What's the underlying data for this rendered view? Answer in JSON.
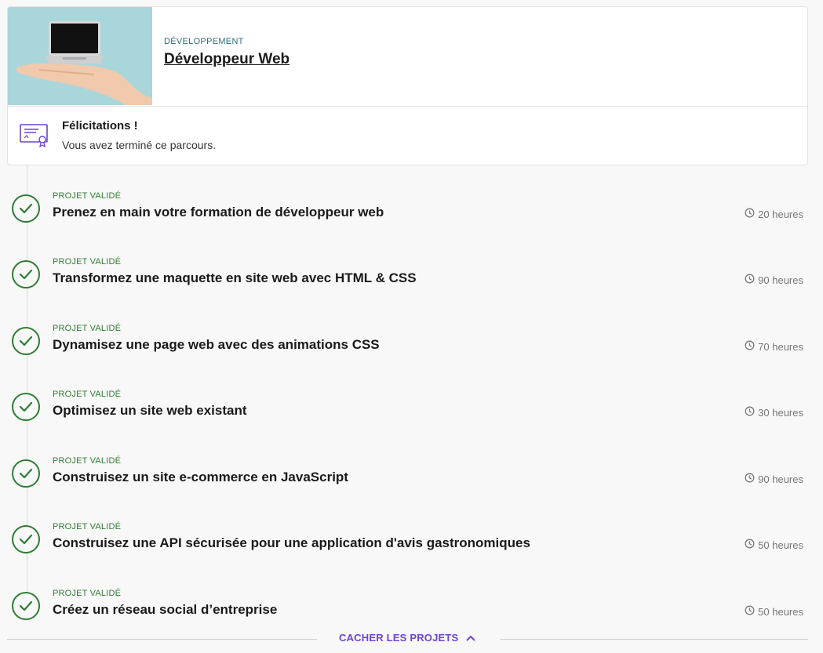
{
  "path": {
    "category": "DÉVELOPPEMENT",
    "title": "Développeur Web"
  },
  "completion": {
    "title": "Félicitations !",
    "message": "Vous avez terminé ce parcours."
  },
  "projects": [
    {
      "status": "PROJET VALIDÉ",
      "title": "Prenez en main votre formation de développeur web",
      "duration": "20 heures"
    },
    {
      "status": "PROJET VALIDÉ",
      "title": "Transformez une maquette en site web avec HTML & CSS",
      "duration": "90 heures"
    },
    {
      "status": "PROJET VALIDÉ",
      "title": "Dynamisez une page web avec des animations CSS",
      "duration": "70 heures"
    },
    {
      "status": "PROJET VALIDÉ",
      "title": "Optimisez un site web existant",
      "duration": "30 heures"
    },
    {
      "status": "PROJET VALIDÉ",
      "title": "Construisez un site e-commerce en JavaScript",
      "duration": "90 heures"
    },
    {
      "status": "PROJET VALIDÉ",
      "title": "Construisez une API sécurisée pour une application d'avis gastronomiques",
      "duration": "50 heures"
    },
    {
      "status": "PROJET VALIDÉ",
      "title": "Créez un réseau social d’entreprise",
      "duration": "50 heures"
    }
  ],
  "footer": {
    "hide_label": "CACHER LES PROJETS"
  },
  "colors": {
    "accent": "#6a44d4",
    "success": "#2e7d32",
    "category": "#2a6f7a"
  },
  "icons": {
    "certificate": "certificate-icon",
    "check": "check-circle-icon",
    "clock": "clock-icon",
    "chevron": "chevron-up-icon"
  }
}
